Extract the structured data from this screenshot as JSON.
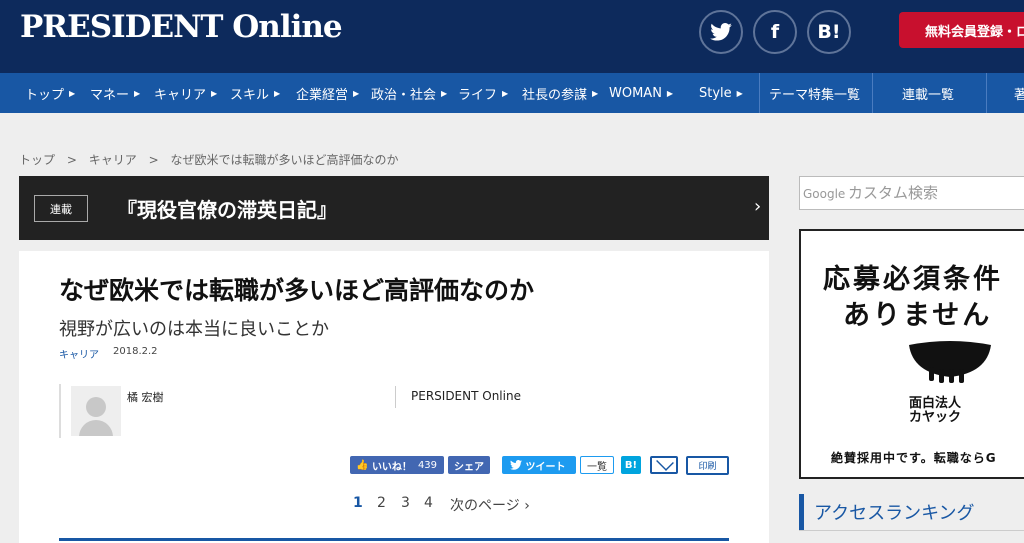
{
  "header": {
    "logo": "PRESIDENT Online",
    "social": [
      "twitter-icon",
      "facebook-icon",
      "hatena-bookmark-icon"
    ],
    "social_labels": {
      "facebook": "f",
      "hatena": "B!"
    },
    "register_label": "無料会員登録・ロ"
  },
  "nav": {
    "items": [
      {
        "label": "トップ"
      },
      {
        "label": "マネー"
      },
      {
        "label": "キャリア"
      },
      {
        "label": "スキル"
      },
      {
        "label": "企業経営"
      },
      {
        "label": "政治・社会"
      },
      {
        "label": "ライフ"
      },
      {
        "label": "社長の参謀"
      },
      {
        "label": "WOMAN"
      },
      {
        "label": "Style"
      },
      {
        "label": "テーマ特集一覧"
      },
      {
        "label": "連載一覧"
      },
      {
        "label": "著"
      }
    ]
  },
  "breadcrumb": {
    "items": [
      "トップ",
      "キャリア",
      "なぜ欧米では転職が多いほど高評価なのか"
    ],
    "separator": ">"
  },
  "series": {
    "badge": "連載",
    "title": "『現役官僚の滞英日記』"
  },
  "article": {
    "title": "なぜ欧米では転職が多いほど高評価なのか",
    "subtitle": "視野が広いのは本当に良いことか",
    "category": "キャリア",
    "date": "2018.2.2",
    "author": "橘 宏樹",
    "publisher": "PERSIDENT Online"
  },
  "share": {
    "like_label": "いいね！",
    "like_count": "439",
    "fb_share_label": "シェア",
    "tweet_label": "ツイート",
    "list_label": "一覧",
    "hatena_label": "B!",
    "print_label": "印刷"
  },
  "pagination": {
    "pages": [
      "1",
      "2",
      "3",
      "4"
    ],
    "current": "1",
    "next_label": "次のページ"
  },
  "sidebar": {
    "search_brand": "Google",
    "search_placeholder": "カスタム検索",
    "ad": {
      "line1": "応募必須条件",
      "line2": "ありません",
      "company": "面白法人\nカヤック",
      "footer": "絶賛採用中です。転職ならG"
    },
    "ranking_title": "アクセスランキング"
  },
  "colors": {
    "header_bg": "#0d2a5c",
    "nav_bg": "#1857a4",
    "accent_red": "#c8102e"
  }
}
